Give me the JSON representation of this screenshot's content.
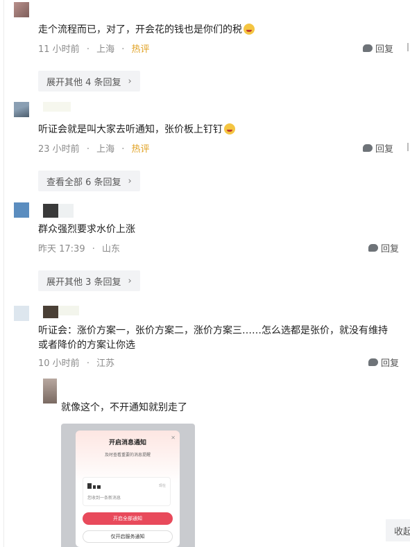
{
  "comments": [
    {
      "text": "走个流程而已，对了，开会花的钱也是你们的税",
      "time": "11 小时前",
      "location": "上海",
      "badge": "热评",
      "reply_label": "回复",
      "more_replies": "展开其他 4 条回复"
    },
    {
      "text": "听证会就是叫大家去听通知，张价板上钉钉",
      "time": "23 小时前",
      "location": "上海",
      "badge": "热评",
      "reply_label": "回复",
      "more_replies": "查看全部 6 条回复"
    },
    {
      "text": "群众强烈要求水价上涨",
      "time": "昨天 17:39",
      "location": "山东",
      "reply_label": "回复",
      "more_replies": "展开其他 3 条回复"
    },
    {
      "text_line1": "听证会：涨价方案一，张价方案二，涨价方案三……怎么选都是张价，就没有维持",
      "text_line2": "或者降价的方案让你选",
      "time": "10 小时前",
      "location": "江苏",
      "reply_label": "回复",
      "sub_reply": {
        "text": "就像这个，不开通知就别走了",
        "screenshot": {
          "title": "开启消息通知",
          "subtitle": "及时查看重要的消息提醒",
          "notification_text": "您收到一条新消息",
          "notification_time": "现在",
          "primary_button": "开启全部通知",
          "secondary_button": "仅开启服务通知"
        }
      }
    }
  ],
  "collapse_label": "收起",
  "separator": "·",
  "chevron": "›",
  "colors": {
    "hot": "#e0a020",
    "meta": "#8a8a8a",
    "button_bg": "#f2f3f5",
    "primary": "#e84a5b"
  }
}
